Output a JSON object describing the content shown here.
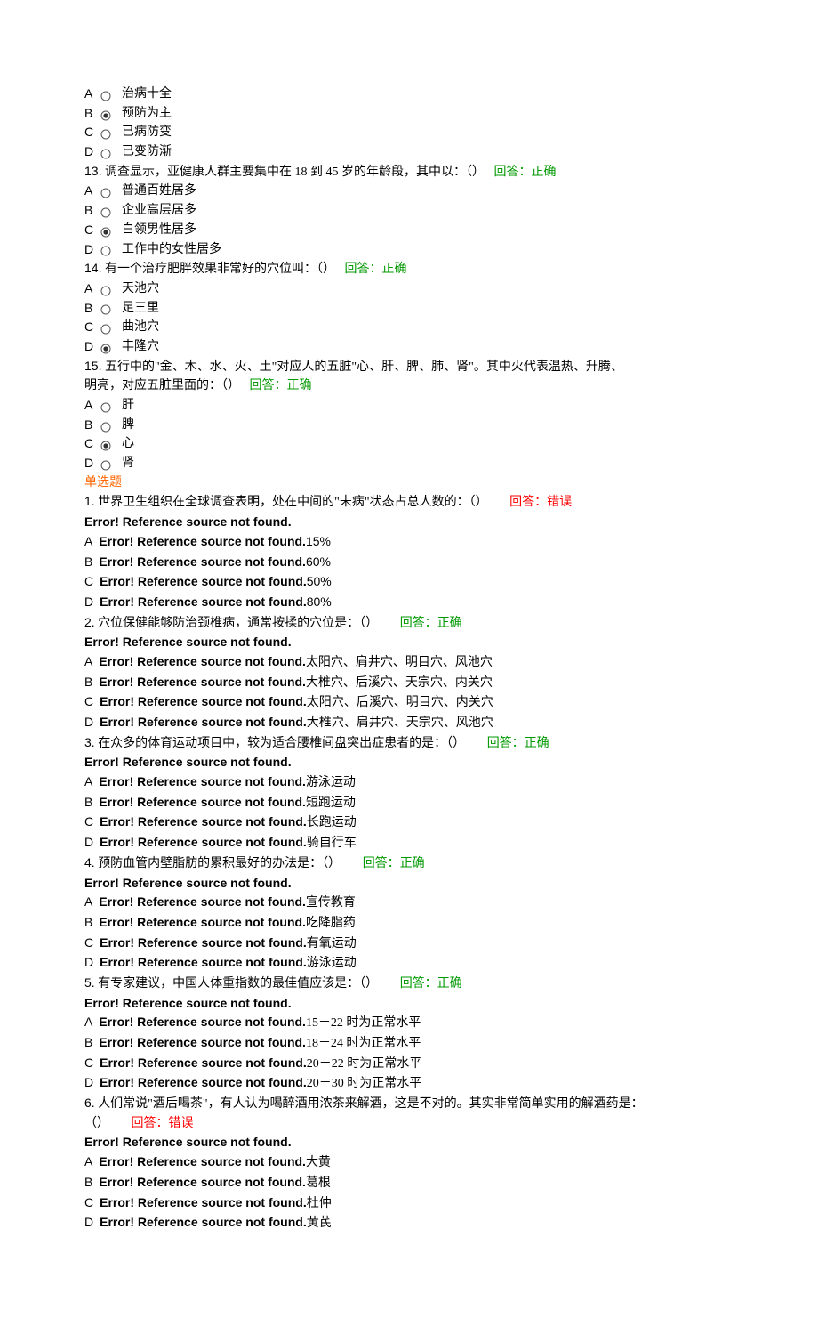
{
  "partA": {
    "q12opts": [
      {
        "l": "A",
        "t": "治病十全",
        "sel": false
      },
      {
        "l": "B",
        "t": "预防为主",
        "sel": true
      },
      {
        "l": "C",
        "t": "已病防变",
        "sel": false
      },
      {
        "l": "D",
        "t": "已变防渐",
        "sel": false
      }
    ],
    "q13": {
      "num": "13.",
      "stem": "调查显示，亚健康人群主要集中在 18 到 45 岁的年龄段，其中以：（）",
      "fb_label": "回答：",
      "fb": "正确",
      "ok": true
    },
    "q13opts": [
      {
        "l": "A",
        "t": "普通百姓居多",
        "sel": false
      },
      {
        "l": "B",
        "t": "企业高层居多",
        "sel": false
      },
      {
        "l": "C",
        "t": "白领男性居多",
        "sel": true
      },
      {
        "l": "D",
        "t": "工作中的女性居多",
        "sel": false
      }
    ],
    "q14": {
      "num": "14.",
      "stem": "有一个治疗肥胖效果非常好的穴位叫：（）",
      "fb_label": "回答：",
      "fb": "正确",
      "ok": true
    },
    "q14opts": [
      {
        "l": "A",
        "t": "天池穴",
        "sel": false
      },
      {
        "l": "B",
        "t": "足三里",
        "sel": false
      },
      {
        "l": "C",
        "t": "曲池穴",
        "sel": false
      },
      {
        "l": "D",
        "t": "丰隆穴",
        "sel": true
      }
    ],
    "q15": {
      "num": "15.",
      "stem_a": "五行中的\"金、木、水、火、土\"对应人的五脏\"心、肝、脾、肺、肾\"。其中火代表温热、升腾、",
      "stem_b": "明亮，对应五脏里面的：（）",
      "fb_label": "回答：",
      "fb": "正确",
      "ok": true
    },
    "q15opts": [
      {
        "l": "A",
        "t": "肝",
        "sel": false
      },
      {
        "l": "B",
        "t": "脾",
        "sel": false
      },
      {
        "l": "C",
        "t": "心",
        "sel": true
      },
      {
        "l": "D",
        "t": "肾",
        "sel": false
      }
    ]
  },
  "section_title": "单选题",
  "err_text": "Error! Reference source not found.",
  "partB": {
    "q1": {
      "num": "1.",
      "stem": "世界卫生组织在全球调查表明，处在中间的\"未病\"状态占总人数的：（）",
      "fb_label": "回答：",
      "fb": "错误",
      "ok": false
    },
    "q1opts": [
      {
        "l": "A",
        "t": "15%"
      },
      {
        "l": "B",
        "t": "60%"
      },
      {
        "l": "C",
        "t": "50%"
      },
      {
        "l": "D",
        "t": "80%"
      }
    ],
    "q2": {
      "num": "2.",
      "stem": "穴位保健能够防治颈椎病，通常按揉的穴位是：（）",
      "fb_label": "回答：",
      "fb": "正确",
      "ok": true
    },
    "q2opts": [
      {
        "l": "A",
        "t": "太阳穴、肩井穴、明目穴、风池穴"
      },
      {
        "l": "B",
        "t": "大椎穴、后溪穴、天宗穴、内关穴"
      },
      {
        "l": "C",
        "t": "太阳穴、后溪穴、明目穴、内关穴"
      },
      {
        "l": "D",
        "t": "大椎穴、肩井穴、天宗穴、风池穴"
      }
    ],
    "q3": {
      "num": "3.",
      "stem": "在众多的体育运动项目中，较为适合腰椎间盘突出症患者的是：（）",
      "fb_label": "回答：",
      "fb": "正确",
      "ok": true
    },
    "q3opts": [
      {
        "l": "A",
        "t": "游泳运动"
      },
      {
        "l": "B",
        "t": "短跑运动"
      },
      {
        "l": "C",
        "t": "长跑运动"
      },
      {
        "l": "D",
        "t": "骑自行车"
      }
    ],
    "q4": {
      "num": "4.",
      "stem": "预防血管内壁脂肪的累积最好的办法是：（）",
      "fb_label": "回答：",
      "fb": "正确",
      "ok": true
    },
    "q4opts": [
      {
        "l": "A",
        "t": "宣传教育"
      },
      {
        "l": "B",
        "t": "吃降脂药"
      },
      {
        "l": "C",
        "t": "有氧运动"
      },
      {
        "l": "D",
        "t": "游泳运动"
      }
    ],
    "q5": {
      "num": "5.",
      "stem": "有专家建议，中国人体重指数的最佳值应该是：（）",
      "fb_label": "回答：",
      "fb": "正确",
      "ok": true
    },
    "q5opts": [
      {
        "l": "A",
        "t": "15－22 时为正常水平"
      },
      {
        "l": "B",
        "t": "18－24 时为正常水平"
      },
      {
        "l": "C",
        "t": "20－22 时为正常水平"
      },
      {
        "l": "D",
        "t": "20－30 时为正常水平"
      }
    ],
    "q6": {
      "num": "6.",
      "stem_a": "人们常说\"酒后喝茶\"，有人认为喝醉酒用浓茶来解酒，这是不对的。其实非常简单实用的解酒药是：",
      "stem_b": "（）",
      "fb_label": "回答：",
      "fb": "错误",
      "ok": false
    },
    "q6opts": [
      {
        "l": "A",
        "t": "大黄"
      },
      {
        "l": "B",
        "t": "葛根"
      },
      {
        "l": "C",
        "t": "杜仲"
      },
      {
        "l": "D",
        "t": "黄芪"
      }
    ]
  }
}
